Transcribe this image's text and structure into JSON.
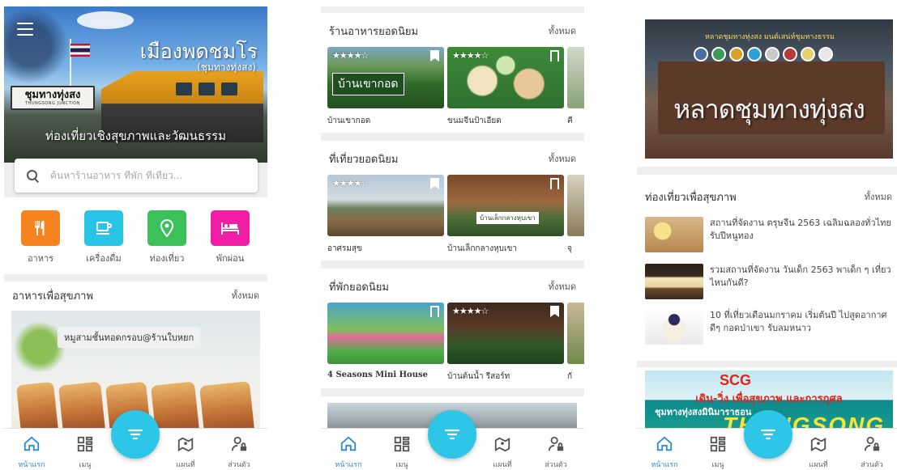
{
  "colors": {
    "accent": "#2ec6e6",
    "nav_active": "#2a8bd6",
    "cat_food": "#f5841f",
    "cat_drinks": "#29c4e6",
    "cat_travel": "#3cc15a",
    "cat_rest": "#f01ea6"
  },
  "home": {
    "title": "เมืองพดชมโร",
    "subtitle": "(ชุมทางทุ่งสง)",
    "station_sign": "ชุมทางทุ่งสง",
    "station_sign_en": "THUNGSONG JUNCTION",
    "tagline": "ท่องเที่ยวเชิงสุขภาพและวัฒนธรรม",
    "search": {
      "placeholder": "ค้นหาร้านอาหาร ที่พัก ที่เที่ยว..."
    },
    "categories": [
      {
        "label": "อาหาร",
        "icon": "fork-knife-icon"
      },
      {
        "label": "เครื่องดื่ม",
        "icon": "cup-icon"
      },
      {
        "label": "ท่องเที่ยว",
        "icon": "location-pin-icon"
      },
      {
        "label": "พักผ่อน",
        "icon": "bed-icon"
      }
    ],
    "healthy_food": {
      "title": "อาหารเพื่อสุขภาพ",
      "see_all": "ทั้งหมด",
      "caption": "หมูสามชั้นทอดกรอบ@ร้านใบหยก"
    }
  },
  "explore": {
    "restaurants": {
      "title": "ร้านอาหารยอดนิยม",
      "see_all": "ทั้งหมด",
      "items": [
        {
          "name": "บ้านเขากอด",
          "stars": "★★★★☆",
          "sign": "บ้านเขากอด"
        },
        {
          "name": "ขนมจีนป้าเอียด",
          "stars": "★★★★☆"
        },
        {
          "name": "คี"
        }
      ]
    },
    "attractions": {
      "title": "ที่เที่ยวยอดนิยม",
      "see_all": "ทั้งหมด",
      "items": [
        {
          "name": "อาศรมสุข",
          "stars": "★★★★☆"
        },
        {
          "name": "บ้านเล็กกลางหุบเขา",
          "sign": "บ้านเล็กกลางหุบเขา"
        },
        {
          "name": "จุ"
        }
      ]
    },
    "lodging": {
      "title": "ที่พักยอดนิยม",
      "see_all": "ทั้งหมด",
      "items": [
        {
          "name": "4 Seasons Mini House"
        },
        {
          "name": "บ้านต้นน้ำ รีสอร์ท",
          "stars": "★★★★☆"
        },
        {
          "name": "กั"
        }
      ]
    }
  },
  "news": {
    "banner": {
      "main": "หลาดชุมทางทุ่งสง",
      "arch": "หลาดชุมทางทุ่งสง มนต์เสน่ห์ชุมทางธรรม"
    },
    "health_travel": {
      "title": "ท่องเที่ยวเพื่อสุขภาพ",
      "see_all": "ทั้งหมด",
      "articles": [
        {
          "title": "สถานที่จัดงาน ตรุษจีน 2563 เฉลิมฉลองทั่วไทย รับปีหนูทอง"
        },
        {
          "title": "รวมสถานที่จัดงาน วันเด็ก 2563 พาเด็ก ๆ เที่ยวไหนกันดี?"
        },
        {
          "title": "10 ที่เที่ยวเดือนมกราคม เริ่มต้นปี ไปสูดอากาศดีๆ กอดป่าเขา รับลมหนาว"
        }
      ]
    },
    "scg": {
      "brand": "SCG",
      "line1": "เดิน-วิ่ง เพื่อสุขภาพ และการกุศล",
      "line2": "ชุมทางทุ่งสงมินิมาราธอน",
      "line3": "THUNGSONG"
    }
  },
  "bottom_nav": {
    "items": [
      {
        "label": "หน้าแรก",
        "icon": "home-icon"
      },
      {
        "label": "เมนู",
        "icon": "grid-icon"
      },
      {
        "label": "แผนที่",
        "icon": "map-pin-icon"
      },
      {
        "label": "ส่วนตัว",
        "icon": "user-lock-icon"
      }
    ],
    "fab_icon": "filter-icon"
  }
}
